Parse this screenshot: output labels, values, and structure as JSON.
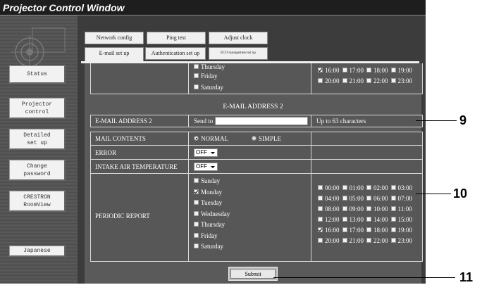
{
  "window": {
    "title": "Projector Control Window"
  },
  "sidebar": {
    "items": [
      {
        "label": "Status",
        "label2": ""
      },
      {
        "label": "Projector",
        "label2": "control"
      },
      {
        "label": "Detailed",
        "label2": "set up"
      },
      {
        "label": "Change",
        "label2": "password"
      },
      {
        "label": "CRESTRON",
        "label2": "RoomView"
      },
      {
        "label": "Japanese",
        "label2": ""
      }
    ]
  },
  "tabs": {
    "row1": [
      "Network config",
      "Ping test",
      "Adjust clock"
    ],
    "row2": [
      "E-mail set up",
      "Authentication set up",
      "ECO management set up"
    ]
  },
  "top_section": {
    "days": [
      "Thursday",
      "Friday",
      "Saturday"
    ],
    "time_rows": [
      [
        {
          "t": "16:00",
          "c": true
        },
        {
          "t": "17:00",
          "c": false
        },
        {
          "t": "18:00",
          "c": false
        },
        {
          "t": "19:00",
          "c": false
        }
      ],
      [
        {
          "t": "20:00",
          "c": false
        },
        {
          "t": "21:00",
          "c": false
        },
        {
          "t": "22:00",
          "c": false
        },
        {
          "t": "23:00",
          "c": false
        }
      ]
    ]
  },
  "email2": {
    "heading": "E-MAIL ADDRESS 2",
    "label": "E-MAIL ADDRESS 2",
    "send_to": "Send to",
    "value": "",
    "hint": "Up to 63 characters"
  },
  "mail_contents": {
    "label": "MAIL CONTENTS",
    "normal": "NORMAL",
    "simple": "SIMPLE"
  },
  "error": {
    "label": "ERROR",
    "value": "OFF"
  },
  "intake": {
    "label": "INTAKE AIR TEMPERATURE",
    "value": "OFF"
  },
  "periodic": {
    "label": "PERIODIC REPORT",
    "days": [
      {
        "d": "Sunday",
        "c": false
      },
      {
        "d": "Monday",
        "c": true
      },
      {
        "d": "Tuesday",
        "c": false
      },
      {
        "d": "Wednesday",
        "c": false
      },
      {
        "d": "Thursday",
        "c": false
      },
      {
        "d": "Friday",
        "c": false
      },
      {
        "d": "Saturday",
        "c": false
      }
    ],
    "time_rows": [
      [
        {
          "t": "00:00",
          "c": false
        },
        {
          "t": "01:00",
          "c": false
        },
        {
          "t": "02:00",
          "c": false
        },
        {
          "t": "03:00",
          "c": false
        }
      ],
      [
        {
          "t": "04:00",
          "c": false
        },
        {
          "t": "05:00",
          "c": false
        },
        {
          "t": "06:00",
          "c": false
        },
        {
          "t": "07:00",
          "c": false
        }
      ],
      [
        {
          "t": "08:00",
          "c": false
        },
        {
          "t": "09:00",
          "c": false
        },
        {
          "t": "10:00",
          "c": false
        },
        {
          "t": "11:00",
          "c": false
        }
      ],
      [
        {
          "t": "12:00",
          "c": false
        },
        {
          "t": "13:00",
          "c": false
        },
        {
          "t": "14:00",
          "c": false
        },
        {
          "t": "15:00",
          "c": false
        }
      ],
      [
        {
          "t": "16:00",
          "c": true
        },
        {
          "t": "17:00",
          "c": false
        },
        {
          "t": "18:00",
          "c": false
        },
        {
          "t": "19:00",
          "c": false
        }
      ],
      [
        {
          "t": "20:00",
          "c": false
        },
        {
          "t": "21:00",
          "c": false
        },
        {
          "t": "22:00",
          "c": false
        },
        {
          "t": "23:00",
          "c": false
        }
      ]
    ]
  },
  "submit": {
    "label": "Submit"
  },
  "callouts": [
    "9",
    "10",
    "11"
  ]
}
